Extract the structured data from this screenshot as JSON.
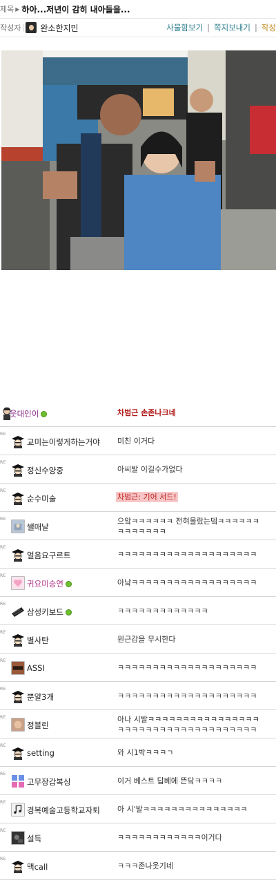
{
  "header": {
    "title_label": "제목",
    "title": "하아...저년이 감히 내아들을...",
    "author_label": "작성자",
    "author_name": "완소한지민",
    "links": [
      "사물함보기",
      "쪽지보내기",
      "작성"
    ]
  },
  "comments": [
    {
      "nick": "웃대인이",
      "online": true,
      "text": "차범근 손존나크네",
      "style": "red",
      "avatar": "person-icon"
    },
    {
      "re": "RE",
      "nick": "교미는이렇게하는거야",
      "online": false,
      "text": "미친 이거다",
      "avatar": "graduate-icon"
    },
    {
      "re": "RE",
      "nick": "정신수양중",
      "online": false,
      "text": "아씨발 이길수가없다",
      "avatar": "graduate-icon"
    },
    {
      "re": "RE",
      "nick": "순수미술",
      "online": false,
      "text": "차범근: 기어 서드!",
      "style": "highlight",
      "avatar": "graduate-icon"
    },
    {
      "re": "RE",
      "nick": "쌜매날",
      "online": false,
      "text": "으앜ㅋㅋㅋㅋㅋㅋ 전혀몰랐는뎈ㅋㅋㅋㅋㅋㅋ",
      "text2": "ㅋㅋㅋㅋㅋㅋㅋ",
      "avatar": "photo-icon"
    },
    {
      "re": "RE",
      "nick": "얼음요구르트",
      "online": false,
      "text": "ㅋㅋㅋㅋㅋㅋㅋㅋㅋㅋㅋㅋㅋㅋㅋㅋㅋㅋㅋㅋ",
      "avatar": "graduate-icon"
    },
    {
      "re": "RE",
      "nick": "귀요미승연",
      "online": true,
      "text": "아낰ㅋㅋㅋㅋㅋㅋㅋㅋㅋㅋㅋㅋㅋㅋㅋㅋㅋㅋ",
      "avatar": "heart-icon"
    },
    {
      "re": "RE",
      "nick": "삼성키보드",
      "online": true,
      "text": "ㅋㅋㅋㅋㅋㅋㅋㅋㅋㅋㅋㅋㅋ",
      "avatar": "keyboard-icon"
    },
    {
      "re": "RE",
      "nick": "별사탄",
      "online": false,
      "text": "원근감을 무시한다",
      "avatar": "graduate-icon"
    },
    {
      "re": "RE",
      "nick": "ASSI",
      "online": false,
      "text": "ㅋㅋㅋㅋㅋㅋㅋㅋㅋㅋㅋㅋㅋㅋㅋㅋㅋㅋㅋㅋ",
      "avatar": "assi-icon"
    },
    {
      "re": "RE",
      "nick": "뿐얄3개",
      "online": false,
      "text": "ㅋㅋㅋㅋㅋㅋㅋㅋㅋㅋㅋㅋㅋㅋㅋㅋㅋㅋㅋㅋ",
      "avatar": "graduate-icon"
    },
    {
      "re": "RE",
      "nick": "정블린",
      "online": false,
      "text": "아나 시발ㅋㅋㅋㅋㅋㅋㅋㅋㅋㅋㅋㅋㅋㅋㅋㅋ",
      "text2": "ㅋㅋㅋㅋㅋㅋㅋㅋㅋㅋㅋㅋㅋㅋㅋㅋㅋㅋㅋㅋ",
      "avatar": "face-icon"
    },
    {
      "re": "RE",
      "nick": "setting",
      "online": false,
      "text": "와 시1박ㅋㅋㅋㄱ",
      "avatar": "graduate-icon"
    },
    {
      "re": "RE",
      "nick": "고무장갑복싱",
      "online": false,
      "text": "이거 베스트 답베에 뜬닼ㅋㅋㅋㅋ",
      "avatar": "gomu-icon"
    },
    {
      "re": "RE",
      "nick": "경복예술고등학교자퇴",
      "online": false,
      "text": "아 시'발ㅋㅋㅋㅋㅋㅋㅋㅋㅋㅋㅋㅋㅋㅋㅋ",
      "avatar": "music-icon"
    },
    {
      "re": "RE",
      "nick": "설득",
      "online": false,
      "text": "ㅋㅋㅋㅋㅋㅋㅋㅋㅋㅋㅋㅋ이거다",
      "avatar": "dark-photo-icon"
    },
    {
      "re": "RE",
      "nick": "맥call",
      "online": false,
      "text": "ㅋㅋㅋ존나웃기네",
      "avatar": "graduate-icon"
    }
  ]
}
